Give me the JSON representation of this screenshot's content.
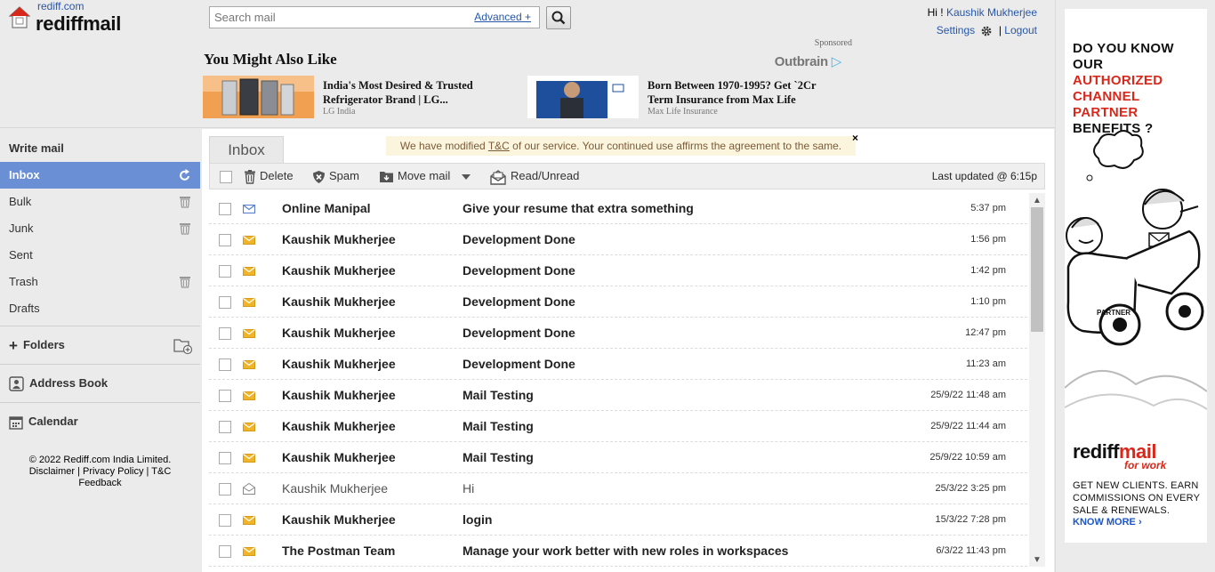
{
  "header": {
    "logo_small": "rediff.com",
    "logo_big": "rediffmail",
    "search_placeholder": "Search mail",
    "advanced_label": "Advanced +",
    "greeting": "Hi !",
    "user_name": "Kaushik Mukherjee",
    "settings_label": "Settings",
    "separator": "|",
    "logout_label": "Logout"
  },
  "recommendations": {
    "heading": "You Might Also Like",
    "sponsored": "Sponsored",
    "outbrain": "Outbrain",
    "cards": [
      {
        "title": "India's Most Desired & Trusted Refrigerator Brand | LG...",
        "source": "LG India"
      },
      {
        "title": "Born Between 1970-1995? Get `2Cr Term Insurance from Max Life",
        "source": "Max Life Insurance"
      }
    ]
  },
  "sidebar": {
    "write_mail": "Write mail",
    "folders": [
      {
        "label": "Inbox"
      },
      {
        "label": "Bulk"
      },
      {
        "label": "Junk"
      },
      {
        "label": "Sent"
      },
      {
        "label": "Trash"
      },
      {
        "label": "Drafts"
      }
    ],
    "folders_label": "Folders",
    "address_book": "Address Book",
    "calendar": "Calendar",
    "footer": {
      "copyright": "© 2022 Rediff.com India Limited.",
      "disclaimer": "Disclaimer",
      "privacy": "Privacy Policy",
      "tc": "T&C",
      "feedback": "Feedback"
    }
  },
  "main": {
    "tab_label": "Inbox",
    "notice_before": "We have modified ",
    "notice_link": "T&C",
    "notice_after": " of our service. Your continued use affirms the agreement to the same.",
    "notice_close": "×",
    "toolbar": {
      "delete": "Delete",
      "spam": "Spam",
      "move": "Move mail",
      "read_unread": "Read/Unread",
      "last_updated": "Last updated  @ 6:15p"
    },
    "mails": [
      {
        "from": "Online Manipal",
        "subject": "Give your resume that extra something",
        "time": "5:37 pm",
        "status": "promo"
      },
      {
        "from": "Kaushik Mukherjee",
        "subject": "Development Done",
        "time": "1:56 pm",
        "status": "unread"
      },
      {
        "from": "Kaushik Mukherjee",
        "subject": "Development Done",
        "time": "1:42 pm",
        "status": "unread"
      },
      {
        "from": "Kaushik Mukherjee",
        "subject": "Development Done",
        "time": "1:10 pm",
        "status": "unread"
      },
      {
        "from": "Kaushik Mukherjee",
        "subject": "Development Done",
        "time": "12:47 pm",
        "status": "unread"
      },
      {
        "from": "Kaushik Mukherjee",
        "subject": "Development Done",
        "time": "11:23 am",
        "status": "unread"
      },
      {
        "from": "Kaushik Mukherjee",
        "subject": "Mail Testing",
        "time": "25/9/22 11:48 am",
        "status": "unread"
      },
      {
        "from": "Kaushik Mukherjee",
        "subject": "Mail Testing",
        "time": "25/9/22 11:44 am",
        "status": "unread"
      },
      {
        "from": "Kaushik Mukherjee",
        "subject": "Mail Testing",
        "time": "25/9/22 10:59 am",
        "status": "unread"
      },
      {
        "from": "Kaushik Mukherjee",
        "subject": "Hi",
        "time": "25/3/22 3:25 pm",
        "status": "read"
      },
      {
        "from": "Kaushik Mukherjee",
        "subject": "login",
        "time": "15/3/22 7:28 pm",
        "status": "unread"
      },
      {
        "from": "The Postman Team",
        "subject": "Manage your work better with new roles in workspaces",
        "time": "6/3/22 11:43 pm",
        "status": "unread"
      }
    ]
  },
  "ad": {
    "line1": "DO YOU KNOW OUR",
    "line2": "AUTHORIZED CHANNEL PARTNER",
    "line3": "BENEFITS ?",
    "brand_rediff": "rediff",
    "brand_mail": "mail",
    "for_work": "for work",
    "body": "GET NEW CLIENTS. EARN COMMISSIONS ON EVERY SALE & RENEWALS.",
    "more": "KNOW MORE ›",
    "partner": "PARTNER"
  },
  "colors": {
    "accent": "#6a8fd4",
    "link": "#2757a8",
    "envelope": "#f0b429",
    "brand_red": "#d8281c"
  }
}
